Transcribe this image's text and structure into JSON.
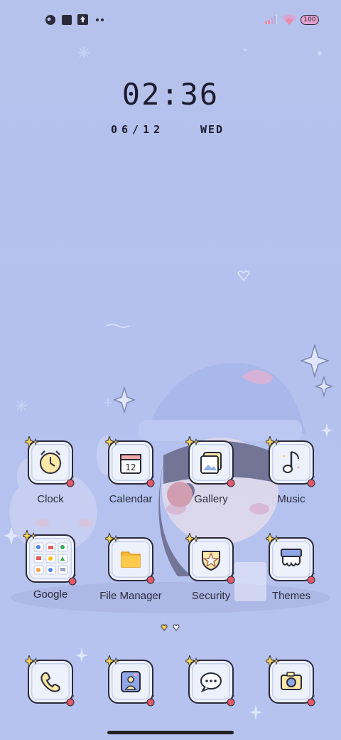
{
  "status_bar": {
    "battery": "100",
    "left_icons": [
      "theme-icon",
      "square-icon",
      "upload-icon",
      "more-dots-icon"
    ],
    "right_icons": [
      "signal-icon",
      "wifi-icon",
      "battery-icon"
    ]
  },
  "lockclock": {
    "time": "02:36",
    "date": "06/12",
    "weekday": "WED"
  },
  "apps": [
    {
      "label": "Clock",
      "icon": "alarm-clock-icon"
    },
    {
      "label": "Calendar",
      "icon": "calendar-icon",
      "day": "12"
    },
    {
      "label": "Gallery",
      "icon": "gallery-icon"
    },
    {
      "label": "Music",
      "icon": "music-note-icon"
    },
    {
      "label": "Google",
      "icon": "google-folder-icon"
    },
    {
      "label": "File Manager",
      "icon": "folder-icon"
    },
    {
      "label": "Security",
      "icon": "shield-star-icon"
    },
    {
      "label": "Themes",
      "icon": "paint-brush-icon"
    }
  ],
  "dock": [
    {
      "icon": "phone-icon"
    },
    {
      "icon": "contacts-icon"
    },
    {
      "icon": "messages-icon"
    },
    {
      "icon": "camera-icon"
    }
  ],
  "page_indicator": {
    "pages": 2,
    "current": 1
  },
  "colors": {
    "background": "#b6c2ec",
    "tile": "#edf1fc",
    "outline": "#2a2a3a",
    "cherry": "#e05a6a",
    "sparkle": "#f5d35a"
  }
}
